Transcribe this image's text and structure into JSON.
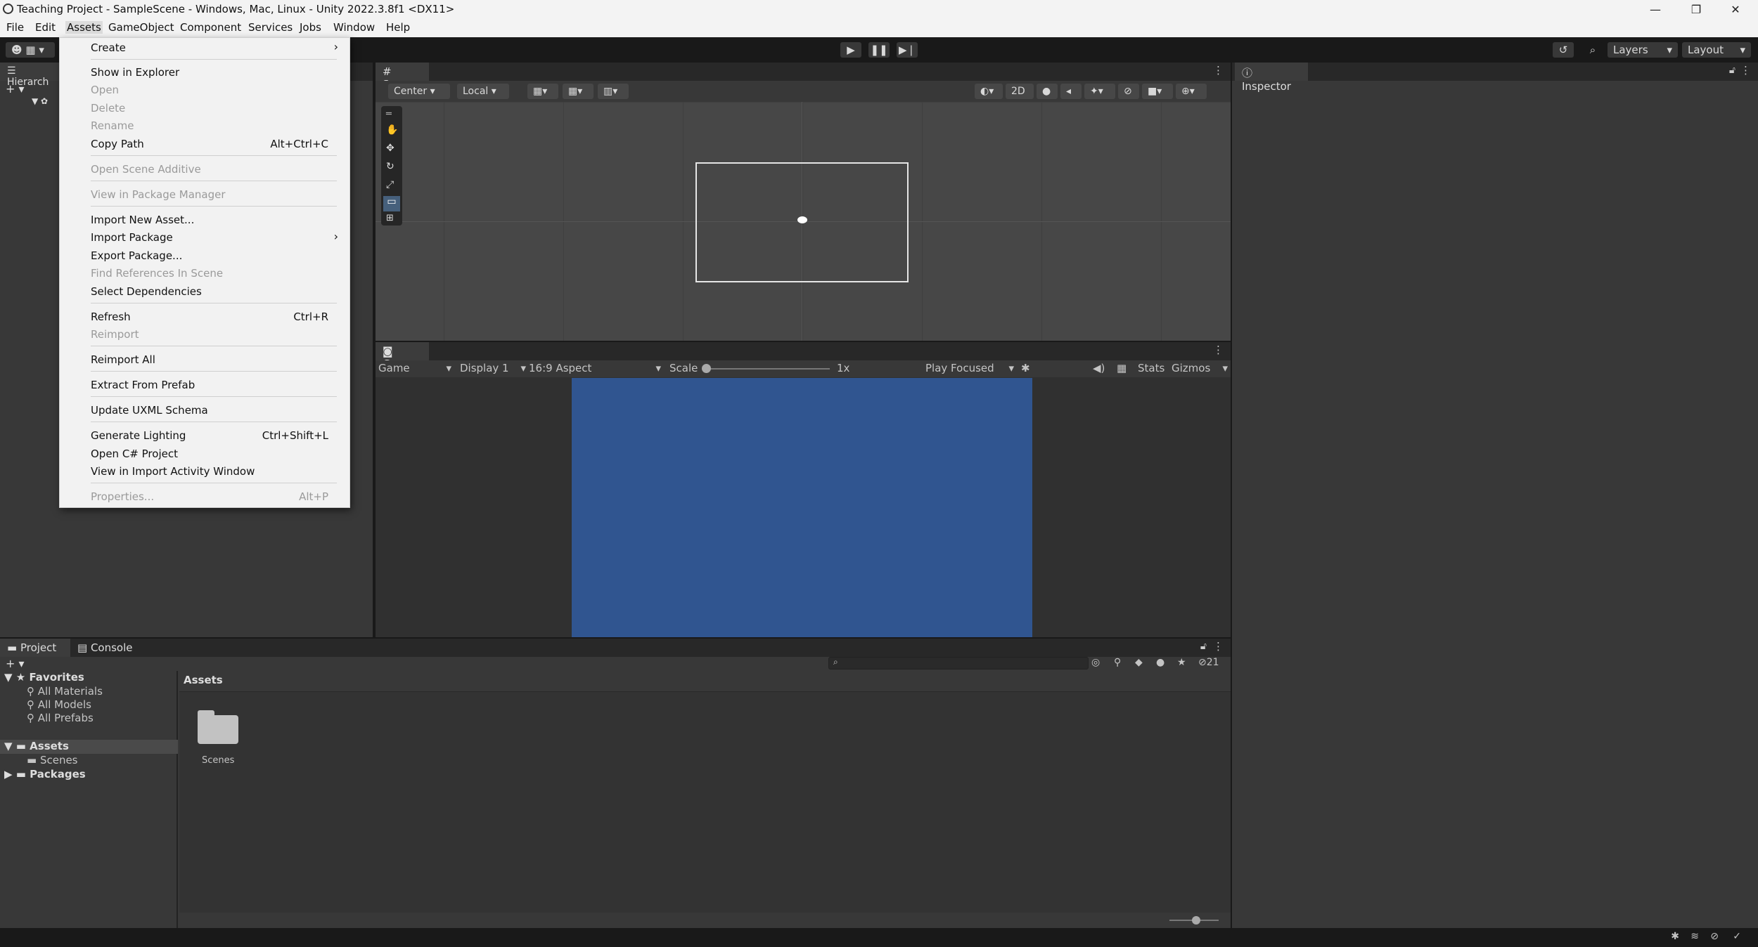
{
  "window": {
    "title": "Teaching Project - SampleScene - Windows, Mac, Linux - Unity 2022.3.8f1 <DX11>",
    "minimize": "—",
    "maximize": "❐",
    "close": "✕"
  },
  "menubar": [
    "File",
    "Edit",
    "Assets",
    "GameObject",
    "Component",
    "Services",
    "Jobs",
    "Window",
    "Help"
  ],
  "toolbar": {
    "layers": "Layers",
    "layout": "Layout"
  },
  "hierarchy": {
    "tab": "Hierarch"
  },
  "scene": {
    "tab": "Scene",
    "pivot": "Center",
    "space": "Local",
    "mode2d": "2D"
  },
  "game": {
    "tab": "Game",
    "view": "Game",
    "display": "Display 1",
    "aspect": "16:9 Aspect",
    "scale_label": "Scale",
    "scale_value": "1x",
    "play_mode": "Play Focused",
    "stats": "Stats",
    "gizmos": "Gizmos"
  },
  "inspector": {
    "tab": "Inspector"
  },
  "project": {
    "tab_project": "Project",
    "tab_console": "Console",
    "favorites": "Favorites",
    "fav_items": [
      "All Materials",
      "All Models",
      "All Prefabs"
    ],
    "assets": "Assets",
    "scenes": "Scenes",
    "packages": "Packages",
    "breadcrumb": "Assets",
    "folder_label": "Scenes",
    "hidden_count": "21"
  },
  "assets_menu": {
    "items": [
      {
        "label": "Create",
        "shortcut": "",
        "enabled": true,
        "submenu": true
      },
      {
        "label": "Show in Explorer",
        "shortcut": "",
        "enabled": true
      },
      {
        "label": "Open",
        "shortcut": "",
        "enabled": false
      },
      {
        "label": "Delete",
        "shortcut": "",
        "enabled": false
      },
      {
        "label": "Rename",
        "shortcut": "",
        "enabled": false
      },
      {
        "label": "Copy Path",
        "shortcut": "Alt+Ctrl+C",
        "enabled": true
      },
      {
        "label": "Open Scene Additive",
        "shortcut": "",
        "enabled": false
      },
      {
        "label": "View in Package Manager",
        "shortcut": "",
        "enabled": false
      },
      {
        "label": "Import New Asset...",
        "shortcut": "",
        "enabled": true
      },
      {
        "label": "Import Package",
        "shortcut": "",
        "enabled": true,
        "submenu": true
      },
      {
        "label": "Export Package...",
        "shortcut": "",
        "enabled": true
      },
      {
        "label": "Find References In Scene",
        "shortcut": "",
        "enabled": false
      },
      {
        "label": "Select Dependencies",
        "shortcut": "",
        "enabled": true
      },
      {
        "label": "Refresh",
        "shortcut": "Ctrl+R",
        "enabled": true
      },
      {
        "label": "Reimport",
        "shortcut": "",
        "enabled": false
      },
      {
        "label": "Reimport All",
        "shortcut": "",
        "enabled": true
      },
      {
        "label": "Extract From Prefab",
        "shortcut": "",
        "enabled": true
      },
      {
        "label": "Update UXML Schema",
        "shortcut": "",
        "enabled": true
      },
      {
        "label": "Generate Lighting",
        "shortcut": "Ctrl+Shift+L",
        "enabled": true
      },
      {
        "label": "Open C# Project",
        "shortcut": "",
        "enabled": true
      },
      {
        "label": "View in Import Activity Window",
        "shortcut": "",
        "enabled": true
      },
      {
        "label": "Properties...",
        "shortcut": "Alt+P",
        "enabled": false
      }
    ]
  }
}
